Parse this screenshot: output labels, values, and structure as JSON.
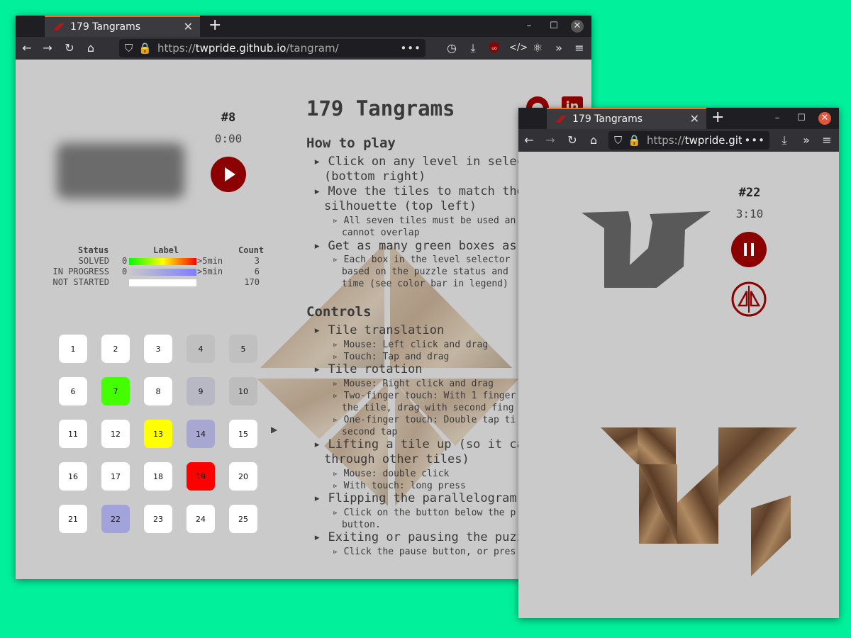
{
  "window_main": {
    "tab_title": "179 Tangrams",
    "url_prefix": "https://",
    "url_host": "twpride.github.io",
    "url_path": "/tangram/",
    "url_menu": "•••"
  },
  "puzzle_main": {
    "number": "#8",
    "time": "0:00"
  },
  "legend": {
    "headers": {
      "status": "Status",
      "label": "Label",
      "count": "Count"
    },
    "rows": [
      {
        "status": "SOLVED",
        "start": "0",
        "end": ">5min",
        "count": "3",
        "colors": [
          "#00ff00",
          "#ffff00",
          "#ff0000"
        ]
      },
      {
        "status": "IN PROGRESS",
        "start": "0",
        "end": ">5min",
        "count": "6",
        "colors": [
          "#c8c8c8",
          "#7f7fff"
        ]
      },
      {
        "status": "NOT STARTED",
        "start": "",
        "end": "",
        "count": "170",
        "colors": [
          "#ffffff"
        ]
      }
    ]
  },
  "levels": [
    {
      "n": "1",
      "c": "#ffffff"
    },
    {
      "n": "2",
      "c": "#ffffff"
    },
    {
      "n": "3",
      "c": "#ffffff"
    },
    {
      "n": "4",
      "c": "#c0c0c0"
    },
    {
      "n": "5",
      "c": "#c0c0c0"
    },
    {
      "n": "6",
      "c": "#ffffff"
    },
    {
      "n": "7",
      "c": "#44ff00"
    },
    {
      "n": "8",
      "c": "#ffffff"
    },
    {
      "n": "9",
      "c": "#b8b8c4"
    },
    {
      "n": "10",
      "c": "#bdbdbd"
    },
    {
      "n": "11",
      "c": "#ffffff"
    },
    {
      "n": "12",
      "c": "#ffffff"
    },
    {
      "n": "13",
      "c": "#ffff00"
    },
    {
      "n": "14",
      "c": "#a7a7d2"
    },
    {
      "n": "15",
      "c": "#ffffff"
    },
    {
      "n": "16",
      "c": "#ffffff"
    },
    {
      "n": "17",
      "c": "#ffffff"
    },
    {
      "n": "18",
      "c": "#ffffff"
    },
    {
      "n": "19",
      "c": "#ff0000"
    },
    {
      "n": "20",
      "c": "#ffffff"
    },
    {
      "n": "21",
      "c": "#ffffff"
    },
    {
      "n": "22",
      "c": "#a3a3dc"
    },
    {
      "n": "23",
      "c": "#ffffff"
    },
    {
      "n": "24",
      "c": "#ffffff"
    },
    {
      "n": "25",
      "c": "#ffffff"
    }
  ],
  "instructions": {
    "title": "179 Tangrams",
    "how_to_play": "How to play",
    "htp_1a": "Click on any level in select",
    "htp_1b": "(bottom right)",
    "htp_2a": "Move the tiles to match the",
    "htp_2b": "silhouette (top left)",
    "htp_2_sub_a": "All seven tiles must be used an",
    "htp_2_sub_b": "cannot overlap",
    "htp_3a": "Get as many green boxes as p",
    "htp_3_sub_a": "Each box in the level selector",
    "htp_3_sub_b": "based on the puzzle status and",
    "htp_3_sub_c": "time (see color bar in legend)",
    "controls": "Controls",
    "c1": "Tile translation",
    "c1_a": "Mouse: Left click and drag",
    "c1_b": "Touch: Tap and drag",
    "c2": "Tile rotation",
    "c2_a": "Mouse: Right click and drag",
    "c2_b1": "Two-finger touch: With 1 finger",
    "c2_b2": "the tile, drag with second fing",
    "c2_c1": "One-finger touch: Double tap ti",
    "c2_c2": "second tap",
    "c3a": "Lifting a tile up (so it can",
    "c3b": "through other tiles)",
    "c3_a": "Mouse: double click",
    "c3_b": "With touch: long press",
    "c4": "Flipping the parallelogram",
    "c4_a1": "Click on the button below the p",
    "c4_a2": "button.",
    "c5": "Exiting or pausing the puzzl",
    "c5_a": "Click the pause button, or pres"
  },
  "window_second": {
    "tab_title": "179 Tangrams",
    "url_prefix": "https://",
    "url_host": "twpride.githu",
    "url_menu": "•••"
  },
  "puzzle_second": {
    "number": "#22",
    "time": "3:10"
  },
  "colors": {
    "accent": "#8b0000",
    "background": "#00f09c"
  }
}
